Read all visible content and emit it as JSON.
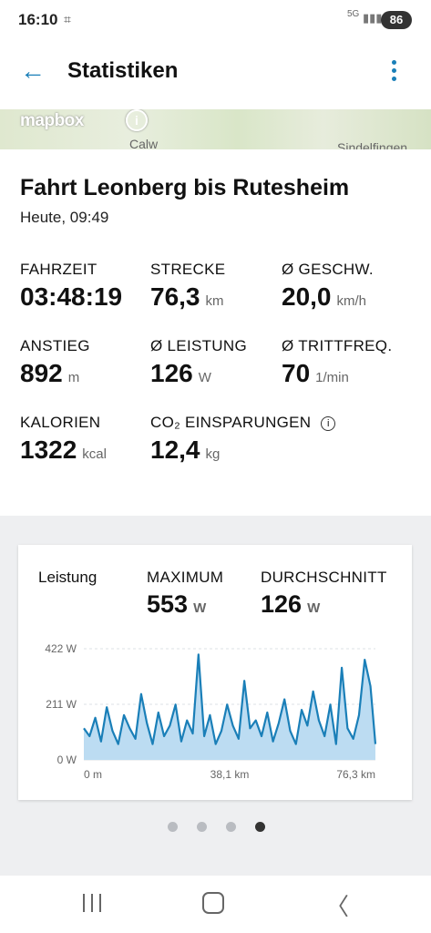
{
  "status_bar": {
    "time": "16:10",
    "screenshot_icon": "screenshot-icon",
    "network": "5G",
    "battery": "86"
  },
  "app_bar": {
    "back_icon": "arrow-back-icon",
    "title": "Statistiken",
    "more_icon": "more-vert-icon"
  },
  "map": {
    "logo": "mapbox",
    "info": "i",
    "place_1": "Calw",
    "place_2": "Sindelfingen"
  },
  "ride": {
    "title": "Fahrt Leonberg bis Rutesheim",
    "date": "Heute, 09:49"
  },
  "stats": [
    {
      "label": "FAHRZEIT",
      "value": "03:48:19",
      "unit": ""
    },
    {
      "label": "STRECKE",
      "value": "76,3",
      "unit": "km"
    },
    {
      "label": "Ø GESCHW.",
      "value": "20,0",
      "unit": "km/h"
    },
    {
      "label": "ANSTIEG",
      "value": "892",
      "unit": "m"
    },
    {
      "label": "Ø LEISTUNG",
      "value": "126",
      "unit": "W"
    },
    {
      "label": "Ø TRITTFREQ.",
      "value": "70",
      "unit": "1/min"
    },
    {
      "label": "KALORIEN",
      "value": "1322",
      "unit": "kcal"
    },
    {
      "label": "CO₂ EINSPARUNGEN",
      "value": "12,4",
      "unit": "kg"
    }
  ],
  "co2_info": "i",
  "chart_card": {
    "label": "Leistung",
    "max_label": "MAXIMUM",
    "max_value": "553",
    "max_unit": "W",
    "avg_label": "DURCHSCHNITT",
    "avg_value": "126",
    "avg_unit": "W"
  },
  "chart_data": {
    "type": "area",
    "x_unit": "km",
    "y_unit": "W",
    "xlim": [
      0,
      76.3
    ],
    "ylim": [
      0,
      422
    ],
    "y_ticks": [
      "422 W",
      "211 W",
      "0 W"
    ],
    "x_ticks": [
      "0 m",
      "38,1 km",
      "76,3 km"
    ],
    "grid": true,
    "color": "#1a7fb8",
    "fill_color": "#bcdcf2",
    "series": [
      {
        "x": [
          0,
          1.5,
          3,
          4.5,
          6,
          7.5,
          9,
          10.5,
          12,
          13.5,
          15,
          16.5,
          18,
          19.5,
          21,
          22.5,
          24,
          25.5,
          27,
          28.5,
          30,
          31.5,
          33,
          34.5,
          36,
          37.5,
          39,
          40.5,
          42,
          43.5,
          45,
          46.5,
          48,
          49.5,
          51,
          52.5,
          54,
          55.5,
          57,
          58.5,
          60,
          61.5,
          63,
          64.5,
          66,
          67.5,
          69,
          70.5,
          72,
          73.5,
          75,
          76.3
        ],
        "values": [
          120,
          90,
          160,
          70,
          200,
          110,
          60,
          170,
          120,
          80,
          250,
          140,
          60,
          180,
          90,
          130,
          210,
          70,
          150,
          100,
          400,
          90,
          170,
          60,
          110,
          210,
          130,
          80,
          300,
          120,
          150,
          90,
          180,
          70,
          140,
          230,
          110,
          60,
          190,
          130,
          260,
          150,
          90,
          210,
          60,
          350,
          120,
          80,
          170,
          380,
          280,
          60
        ]
      }
    ]
  },
  "pager": {
    "count": 4,
    "active": 3
  },
  "nav_bar": {
    "recent_icon": "recent-apps-icon",
    "home_icon": "home-icon",
    "back_icon": "back-icon"
  }
}
